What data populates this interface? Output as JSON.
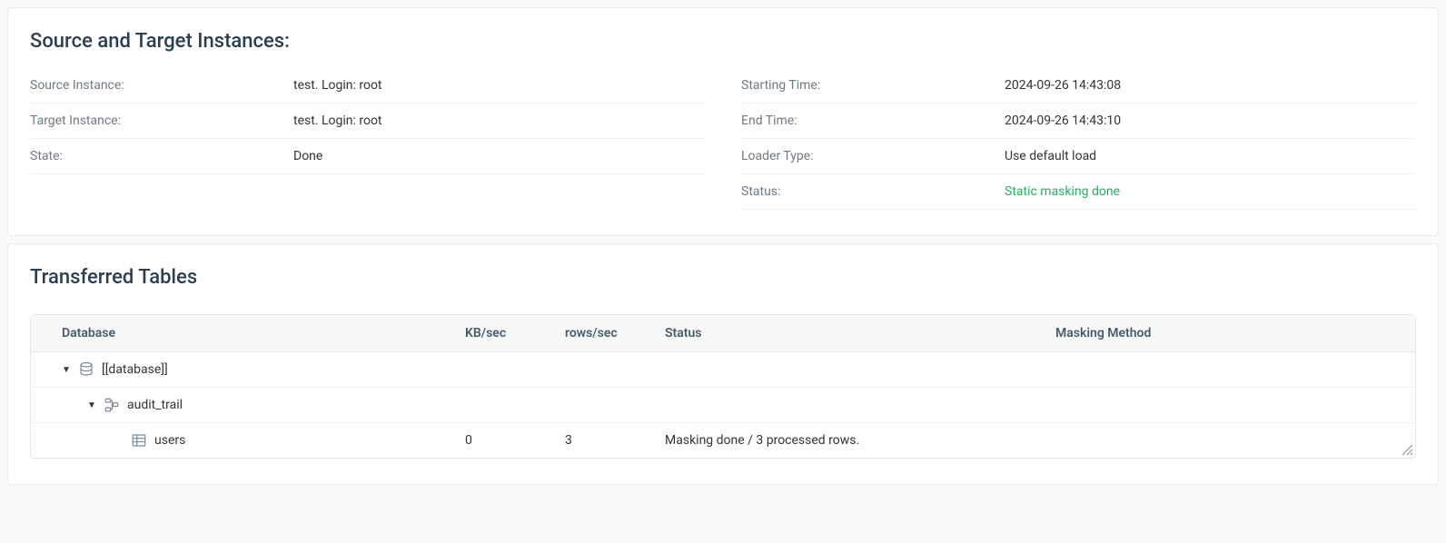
{
  "instances": {
    "title": "Source and Target Instances:",
    "left": [
      {
        "label": "Source Instance:",
        "value": "test. Login: root"
      },
      {
        "label": "Target Instance:",
        "value": "test. Login: root"
      },
      {
        "label": "State:",
        "value": "Done"
      }
    ],
    "right": [
      {
        "label": "Starting Time:",
        "value": "2024-09-26 14:43:08"
      },
      {
        "label": "End Time:",
        "value": "2024-09-26 14:43:10"
      },
      {
        "label": "Loader Type:",
        "value": "Use default load"
      },
      {
        "label": "Status:",
        "value": "Static masking done",
        "green": true
      }
    ]
  },
  "tables": {
    "title": "Transferred Tables",
    "columns": {
      "database": "Database",
      "kbsec": "KB/sec",
      "rowssec": "rows/sec",
      "status": "Status",
      "masking": "Masking Method"
    },
    "rows": {
      "db": {
        "name": "[[database]]"
      },
      "schema": {
        "name": "audit_trail"
      },
      "table": {
        "name": "users",
        "kbsec": "0",
        "rowssec": "3",
        "status": "Masking done / 3 processed rows.",
        "masking": ""
      }
    }
  }
}
